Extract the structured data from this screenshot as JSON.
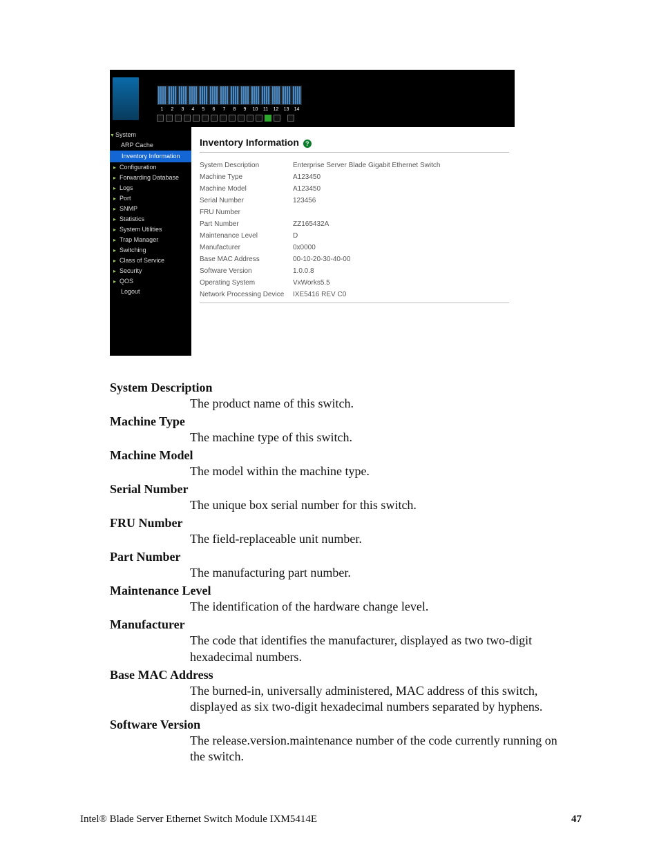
{
  "ui": {
    "ports": [
      "1",
      "2",
      "3",
      "4",
      "5",
      "6",
      "7",
      "8",
      "9",
      "10",
      "11",
      "12",
      "13",
      "14"
    ],
    "active_port_index": 12,
    "sidebar": [
      {
        "label": "System",
        "cls": "lvl1"
      },
      {
        "label": "ARP Cache",
        "cls": "leaf nolead"
      },
      {
        "label": "Inventory Information",
        "cls": "leaf sel nolead"
      },
      {
        "label": "Configuration",
        "cls": "lvl2"
      },
      {
        "label": "Forwarding Database",
        "cls": "lvl2"
      },
      {
        "label": "Logs",
        "cls": "lvl2"
      },
      {
        "label": "Port",
        "cls": "lvl2"
      },
      {
        "label": "SNMP",
        "cls": "lvl2"
      },
      {
        "label": "Statistics",
        "cls": "lvl2"
      },
      {
        "label": "System Utilities",
        "cls": "lvl2"
      },
      {
        "label": "Trap Manager",
        "cls": "lvl2"
      },
      {
        "label": "Switching",
        "cls": "lvl2"
      },
      {
        "label": "Class of Service",
        "cls": "lvl2"
      },
      {
        "label": "Security",
        "cls": "lvl2"
      },
      {
        "label": "QOS",
        "cls": "lvl2"
      },
      {
        "label": "Logout",
        "cls": "leaf nolead"
      }
    ],
    "title": "Inventory Information",
    "rows": [
      {
        "k": "System Description",
        "v": "Enterprise Server Blade Gigabit Ethernet Switch"
      },
      {
        "k": "Machine Type",
        "v": "A123450"
      },
      {
        "k": "Machine Model",
        "v": "A123450"
      },
      {
        "k": "Serial Number",
        "v": "123456"
      },
      {
        "k": "FRU Number",
        "v": ""
      },
      {
        "k": "Part Number",
        "v": "ZZ165432A"
      },
      {
        "k": "Maintenance Level",
        "v": "D"
      },
      {
        "k": "Manufacturer",
        "v": "0x0000"
      },
      {
        "k": "Base MAC Address",
        "v": "00-10-20-30-40-00"
      },
      {
        "k": "Software Version",
        "v": "1.0.0.8"
      },
      {
        "k": "Operating System",
        "v": "VxWorks5.5"
      },
      {
        "k": "Network Processing Device",
        "v": "IXE5416 REV C0"
      }
    ]
  },
  "doc": {
    "defs": [
      {
        "t": "System Description",
        "d": "The product name of this switch."
      },
      {
        "t": "Machine Type",
        "d": "The machine type of this switch."
      },
      {
        "t": "Machine Model",
        "d": "The model within the machine type."
      },
      {
        "t": "Serial Number",
        "d": "The unique box serial number for this switch."
      },
      {
        "t": "FRU Number",
        "d": "The field-replaceable unit number."
      },
      {
        "t": "Part Number",
        "d": "The manufacturing part number."
      },
      {
        "t": "Maintenance Level",
        "d": "The identification of the hardware change level."
      },
      {
        "t": "Manufacturer",
        "d": "The code that identifies the manufacturer, displayed as two two-digit hexadecimal numbers."
      },
      {
        "t": "Base MAC Address",
        "d": "The burned-in, universally administered, MAC address of this switch, displayed as six two-digit hexadecimal numbers separated by hyphens."
      },
      {
        "t": "Software Version",
        "d": "The release.version.maintenance number of the code currently running on the switch."
      }
    ],
    "footer_left": "Intel® Blade Server Ethernet Switch Module IXM5414E",
    "footer_right": "47"
  }
}
